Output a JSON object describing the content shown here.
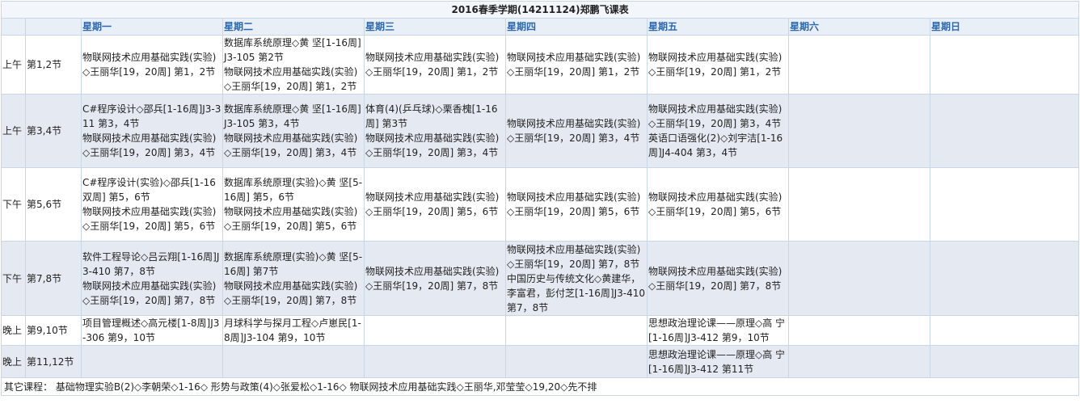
{
  "title": "2016春季学期(14211124)郑鹏飞课表",
  "days": [
    "星期一",
    "星期二",
    "星期三",
    "星期四",
    "星期五",
    "星期六",
    "星期日"
  ],
  "rows": [
    {
      "period": "上午",
      "slot": "第1,2节",
      "cells": [
        [
          "物联网技术应用基础实践(实验)◇王丽华[19，20周] 第1，2节"
        ],
        [
          "数据库系统原理◇黄 坚[1-16周]J3-105 第2节",
          "物联网技术应用基础实践(实验)◇王丽华[19，20周] 第1，2节"
        ],
        [
          "物联网技术应用基础实践(实验)◇王丽华[19，20周] 第1，2节"
        ],
        [
          "物联网技术应用基础实践(实验)◇王丽华[19，20周] 第1，2节"
        ],
        [
          "物联网技术应用基础实践(实验)◇王丽华[19，20周] 第1，2节"
        ],
        [],
        []
      ]
    },
    {
      "period": "上午",
      "slot": "第3,4节",
      "cells": [
        [
          "C#程序设计◇邵兵[1-16周]J3-311 第3，4节",
          "物联网技术应用基础实践(实验)◇王丽华[19，20周] 第3，4节"
        ],
        [
          "数据库系统原理◇黄 坚[1-16周]J3-105 第3，4节",
          "物联网技术应用基础实践(实验)◇王丽华[19，20周] 第3，4节"
        ],
        [
          "体育(4)(乒乓球)◇栗香槐[1-16周] 第3节",
          "物联网技术应用基础实践(实验)◇王丽华[19，20周] 第3，4节"
        ],
        [
          "物联网技术应用基础实践(实验)◇王丽华[19，20周] 第3，4节"
        ],
        [
          "物联网技术应用基础实践(实验)◇王丽华[19，20周] 第3，4节",
          "英语口语强化(2)◇刘宇洁[1-16周]J4-404 第3，4节"
        ],
        [],
        []
      ]
    },
    {
      "period": "下午",
      "slot": "第5,6节",
      "cells": [
        [
          "C#程序设计(实验)◇邵兵[1-16双周] 第5，6节",
          "物联网技术应用基础实践(实验)◇王丽华[19，20周] 第5，6节"
        ],
        [
          "数据库系统原理(实验)◇黄 坚[5-16周] 第5，6节",
          "物联网技术应用基础实践(实验)◇王丽华[19，20周] 第5，6节"
        ],
        [
          "物联网技术应用基础实践(实验)◇王丽华[19，20周] 第5，6节"
        ],
        [
          "物联网技术应用基础实践(实验)◇王丽华[19，20周] 第5，6节"
        ],
        [
          "物联网技术应用基础实践(实验)◇王丽华[19，20周] 第5，6节"
        ],
        [],
        []
      ]
    },
    {
      "period": "下午",
      "slot": "第7,8节",
      "cells": [
        [
          "软件工程导论◇吕云翔[1-16周]J3-410 第7，8节",
          "物联网技术应用基础实践(实验)◇王丽华[19，20周] 第7，8节"
        ],
        [
          "数据库系统原理(实验)◇黄 坚[5-16周] 第7节",
          "物联网技术应用基础实践(实验)◇王丽华[19，20周] 第7，8节"
        ],
        [
          "物联网技术应用基础实践(实验)◇王丽华[19，20周] 第7，8节"
        ],
        [
          "物联网技术应用基础实践(实验)◇王丽华[19，20周] 第7，8节",
          "中国历史与传统文化◇黄建华，李富君，彭付芝[1-16周]J3-410 第7，8节"
        ],
        [
          "物联网技术应用基础实践(实验)◇王丽华[19，20周] 第7，8节"
        ],
        [],
        []
      ]
    },
    {
      "period": "晚上",
      "slot": "第9,10节",
      "cells": [
        [
          "项目管理概述◇高元楼[1-8周]J3-306 第9，10节"
        ],
        [
          "月球科学与探月工程◇卢崽民[1-8周]J3-104 第9，10节"
        ],
        [],
        [],
        [
          "思想政治理论课——原理◇高 宁[1-16周]J3-412 第9，10节"
        ],
        [],
        []
      ]
    },
    {
      "period": "晚上",
      "slot": "第11,12节",
      "cells": [
        [],
        [],
        [],
        [],
        [
          "思想政治理论课——原理◇高 宁[1-16周]J3-412 第11节"
        ],
        [],
        []
      ]
    }
  ],
  "other_courses": "其它课程： 基础物理实验B(2)◇李朝荣◇1-16◇ 形势与政策(4)◇张爱松◇1-16◇ 物联网技术应用基础实践◇王丽华,邓莹莹◇19,20◇先不排",
  "colors": {
    "header_text": "#2a67b1",
    "border": "#c8d6e6",
    "alt_row": "#e5eaf2"
  }
}
